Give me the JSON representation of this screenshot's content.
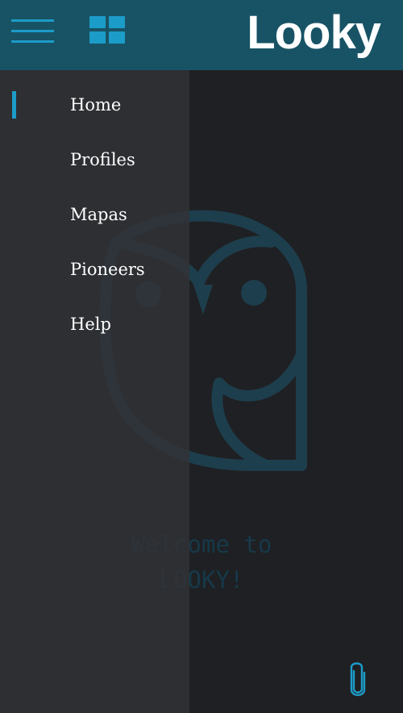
{
  "header": {
    "menu_icon": "hamburger-menu-icon",
    "grid_icon": "grid-view-icon",
    "brand": "Looky",
    "colors": {
      "bar": "#185365",
      "accent": "#1c9cc8",
      "brand_text": "#ffffff"
    }
  },
  "drawer": {
    "items": [
      {
        "label": "Home",
        "active": true
      },
      {
        "label": "Profiles",
        "active": false
      },
      {
        "label": "Mapas",
        "active": false
      },
      {
        "label": "Pioneers",
        "active": false
      },
      {
        "label": "Help",
        "active": false
      }
    ],
    "colors": {
      "background": "#313236",
      "indicator": "#1c9cc8",
      "text": "#ffffff"
    }
  },
  "main": {
    "logo_icon": "owl-icon",
    "welcome_line1": "Welcome to",
    "welcome_line2": "LOOKY!",
    "attach_icon": "paperclip-icon",
    "colors": {
      "background": "#1f2023",
      "logo": "#1d3e4d",
      "welcome": "#16394a",
      "attach": "#1c9cc8"
    }
  }
}
